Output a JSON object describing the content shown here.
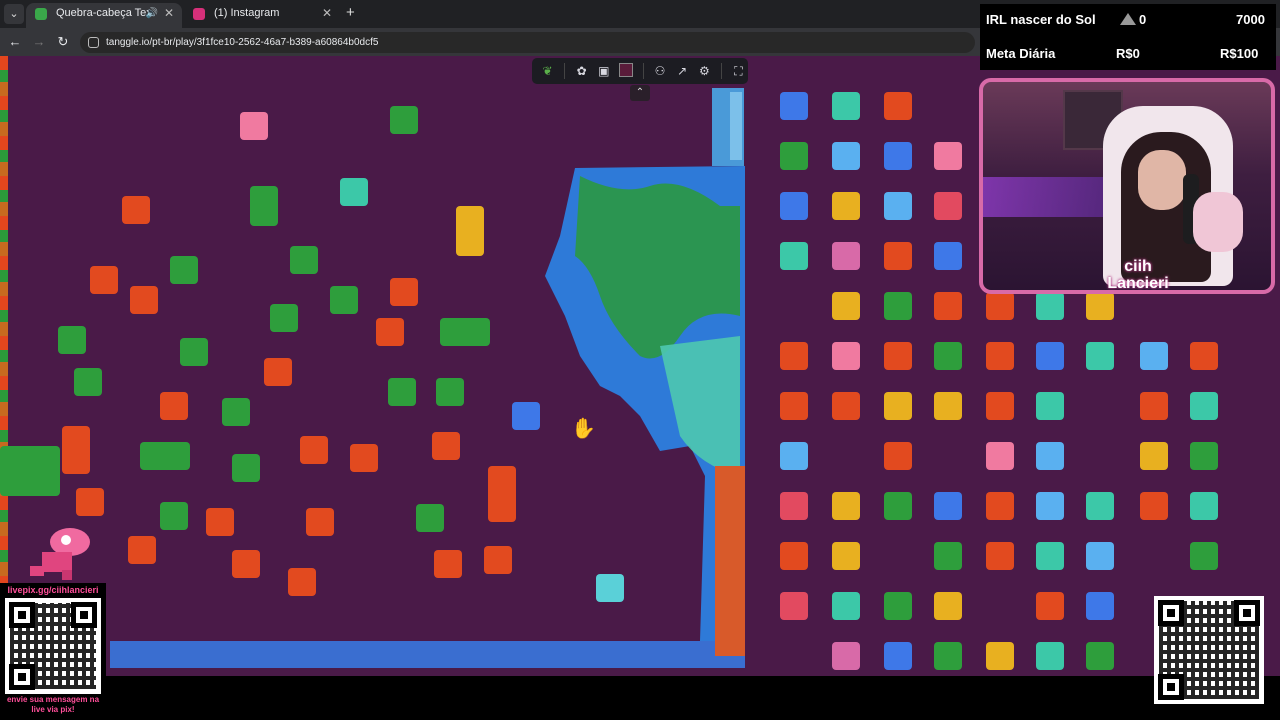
{
  "browser": {
    "tabs": [
      {
        "label": "Quebra-cabeça Texturas",
        "active": true,
        "favicon_color": "#3aa84a",
        "audio_icon": "speaker-icon"
      },
      {
        "label": "(1) Instagram",
        "active": false,
        "favicon_color": "#d6307a"
      }
    ],
    "new_tab_label": "+",
    "address": "tanggle.io/pt-br/play/3f1fce10-2562-46a7-b389-a60864b0dcf5"
  },
  "toolbar": {
    "buttons": [
      "logo-icon",
      "pieces-icon",
      "image-icon",
      "color-swatch",
      "users-icon",
      "share-icon",
      "settings-icon",
      "fullscreen-icon"
    ],
    "swatch_color": "#5a1c3a",
    "collapse_label": "⌃"
  },
  "stream": {
    "goal1_label": "IRL nascer do Sol",
    "goal1_current": "0",
    "goal1_target": "7000",
    "goal2_label": "Meta Diária",
    "goal2_current": "R$0",
    "goal2_target": "R$100",
    "streamer_name_line1": "ciih",
    "streamer_name_line2": "Lancieri",
    "livepix_url": "livepix.gg/ciihlancieri",
    "livepix_cta": "envie sua mensagem na live via pix!"
  },
  "colors": {
    "background": "#4a1a48",
    "accent_pink": "#d86aa8",
    "piece_green": "#2e9e3c",
    "piece_orange": "#e24a1f",
    "piece_blue": "#3e78e8",
    "piece_teal": "#3cc8a8"
  }
}
